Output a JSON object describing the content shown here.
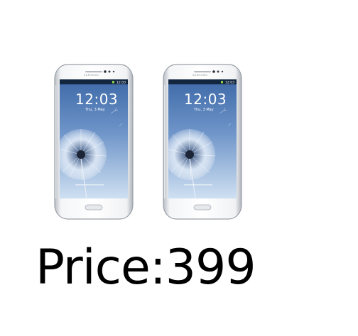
{
  "products": [
    {
      "name": "phone-left",
      "brand_mark": "SAMSUNG",
      "clock": "12:03",
      "date": "Thu, 3 May",
      "status_time": "12:03"
    },
    {
      "name": "phone-right",
      "brand_mark": "SAMSUNG",
      "clock": "12:03",
      "date": "Thu, 3 May",
      "status_time": "12:03"
    }
  ],
  "price": {
    "label": "Price:399"
  },
  "colors": {
    "background": "#ffffff",
    "text": "#000000",
    "phone_body": "#eef0f3",
    "screen_sky": "#6f95c9"
  }
}
